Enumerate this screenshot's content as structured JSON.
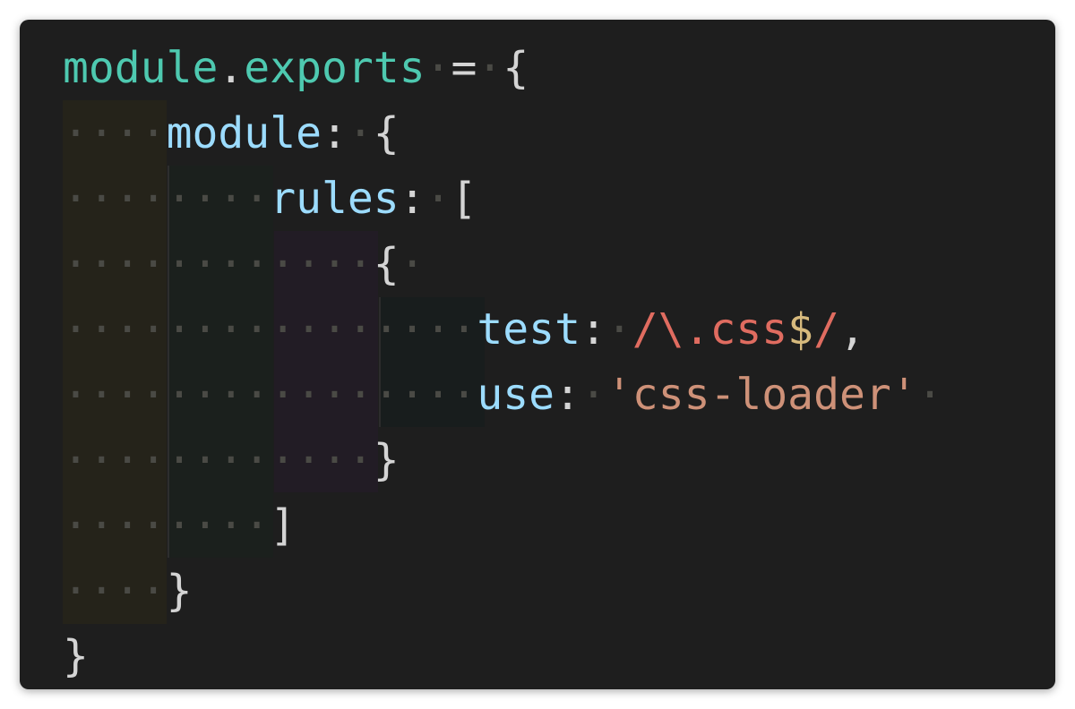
{
  "editor": {
    "language": "javascript",
    "lines": [
      {
        "indent": "",
        "tokens": [
          {
            "text": "module",
            "kind": "obj"
          },
          {
            "text": ".",
            "kind": "punc"
          },
          {
            "text": "exports",
            "kind": "obj"
          },
          {
            "text": "·",
            "kind": "ws"
          },
          {
            "text": "=",
            "kind": "punc"
          },
          {
            "text": "·",
            "kind": "ws"
          },
          {
            "text": "{",
            "kind": "punc"
          }
        ]
      },
      {
        "indent": "····",
        "tokens": [
          {
            "text": "module",
            "kind": "prop"
          },
          {
            "text": ":",
            "kind": "punc"
          },
          {
            "text": "·",
            "kind": "ws"
          },
          {
            "text": "{",
            "kind": "punc"
          }
        ]
      },
      {
        "indent": "········",
        "tokens": [
          {
            "text": "rules",
            "kind": "prop"
          },
          {
            "text": ":",
            "kind": "punc"
          },
          {
            "text": "·",
            "kind": "ws"
          },
          {
            "text": "[",
            "kind": "punc"
          }
        ]
      },
      {
        "indent": "············",
        "tokens": [
          {
            "text": "{",
            "kind": "punc"
          },
          {
            "text": "·",
            "kind": "ws"
          }
        ]
      },
      {
        "indent": "················",
        "tokens": [
          {
            "text": "test",
            "kind": "prop"
          },
          {
            "text": ":",
            "kind": "punc"
          },
          {
            "text": "·",
            "kind": "ws"
          },
          {
            "text": "/\\.css",
            "kind": "regex"
          },
          {
            "text": "$",
            "kind": "regex-esc"
          },
          {
            "text": "/",
            "kind": "regex"
          },
          {
            "text": ",",
            "kind": "punc"
          }
        ]
      },
      {
        "indent": "················",
        "tokens": [
          {
            "text": "use",
            "kind": "prop"
          },
          {
            "text": ":",
            "kind": "punc"
          },
          {
            "text": "·",
            "kind": "ws"
          },
          {
            "text": "'css-loader'",
            "kind": "str"
          },
          {
            "text": "·",
            "kind": "ws"
          }
        ]
      },
      {
        "indent": "············",
        "tokens": [
          {
            "text": "}",
            "kind": "punc"
          }
        ]
      },
      {
        "indent": "········",
        "tokens": [
          {
            "text": "]",
            "kind": "punc"
          }
        ]
      },
      {
        "indent": "····",
        "tokens": [
          {
            "text": "}",
            "kind": "punc"
          }
        ]
      },
      {
        "indent": "",
        "tokens": [
          {
            "text": "}",
            "kind": "punc"
          }
        ]
      }
    ]
  }
}
